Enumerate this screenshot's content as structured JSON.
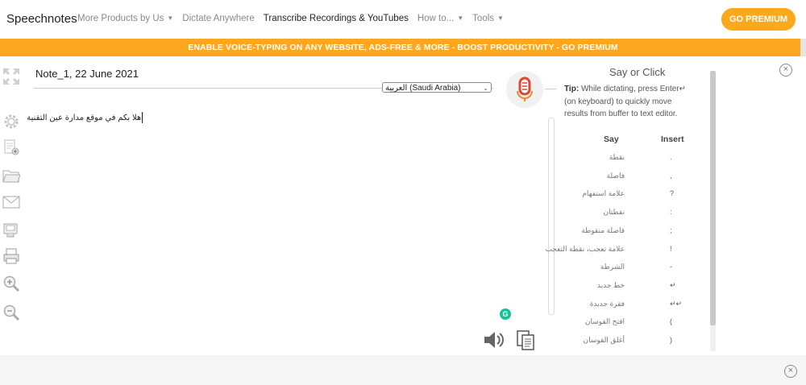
{
  "nav": {
    "brand": "Speechnotes",
    "items": [
      {
        "label": "More Products by Us",
        "caret": true,
        "dark": false
      },
      {
        "label": "Dictate Anywhere",
        "caret": false,
        "dark": false
      },
      {
        "label": "Transcribe Recordings & YouTubes",
        "caret": false,
        "dark": true
      },
      {
        "label": "How to...",
        "caret": true,
        "dark": false
      },
      {
        "label": "Tools",
        "caret": true,
        "dark": false
      }
    ],
    "go_premium": "GO PREMIUM"
  },
  "banner": {
    "text": "ENABLE VOICE-TYPING ON ANY WEBSITE, ADS-FREE & MORE  -  BOOST PRODUCTIVITY - GO PREMIUM",
    "color": "#fca71f"
  },
  "tools": [
    "fullscreen-icon",
    "settings-icon",
    "new-note-icon",
    "open-folder-icon",
    "email-icon",
    "save-icon",
    "print-icon",
    "zoom-in-icon",
    "zoom-out-icon"
  ],
  "editor": {
    "title": "Note_1, 22 June 2021",
    "language": "العربية (Saudi Arabia)",
    "text": "أهلا بكم في موقع مدارة عين التقنية"
  },
  "panel": {
    "title": "Say or Click",
    "tip_label": "Tip:",
    "tip_text": "While dictating, press Enter↵ (on keyboard) to quickly move results from buffer to text editor.",
    "col_say": "Say",
    "col_insert": "Insert",
    "commands": [
      {
        "say": "نقطة",
        "insert": "."
      },
      {
        "say": "فاصلة",
        "insert": ","
      },
      {
        "say": "علامة استفهام",
        "insert": "?"
      },
      {
        "say": "نقطتان",
        "insert": ":"
      },
      {
        "say": "فاصلة منقوطة",
        "insert": ";"
      },
      {
        "say": "علامة تعجب، نقطة التعجب",
        "insert": "!"
      },
      {
        "say": "الشرطة",
        "insert": "-"
      },
      {
        "say": "خط جديد",
        "insert": "↵"
      },
      {
        "say": "فقرة جديدة",
        "insert": "↵↵"
      },
      {
        "say": "افتح القوسان",
        "insert": "("
      },
      {
        "say": "أغلق القوسان",
        "insert": ")"
      }
    ]
  },
  "colors": {
    "accent": "#fba81b",
    "mic_red": "#e2462f",
    "grammarly": "#15c39a"
  }
}
